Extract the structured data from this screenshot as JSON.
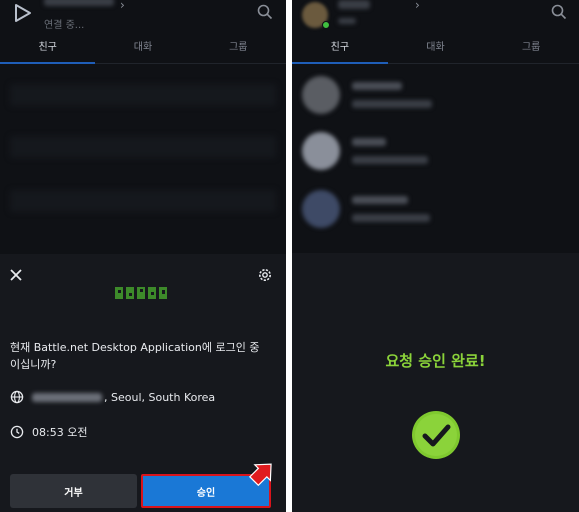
{
  "left": {
    "status": "연결 중...",
    "tabs": [
      "친구",
      "대화",
      "그룹"
    ],
    "sheet": {
      "question": "현재 Battle.net Desktop Application에 로그인 중이십니까?",
      "location": "Seoul, South Korea",
      "time": "08:53 오전",
      "deny_label": "거부",
      "approve_label": "승인"
    }
  },
  "right": {
    "tabs": [
      "친구",
      "대화",
      "그룹"
    ],
    "done_text": "요청 승인 완료!"
  },
  "colors": {
    "accent_blue": "#1a78d6",
    "success_green": "#8bd33a",
    "highlight_red": "#d9141b"
  }
}
